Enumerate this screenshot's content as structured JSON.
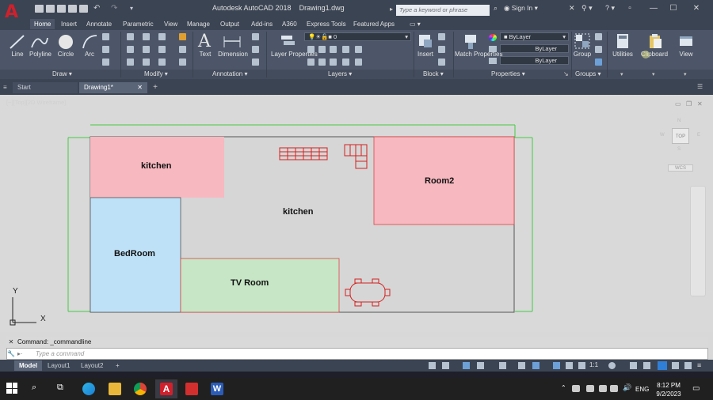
{
  "app": {
    "title": "Autodesk AutoCAD 2018",
    "document": "Drawing1.dwg",
    "search_placeholder": "Type a keyword or phrase",
    "sign_in": "Sign In",
    "logo_letter": "A"
  },
  "menu_tabs": [
    "Home",
    "Insert",
    "Annotate",
    "Parametric",
    "View",
    "Manage",
    "Output",
    "Add-ins",
    "A360",
    "Express Tools",
    "Featured Apps"
  ],
  "active_tab": "Home",
  "ribbon": {
    "draw": {
      "label": "Draw",
      "tools": [
        "Line",
        "Polyline",
        "Circle",
        "Arc"
      ]
    },
    "modify": {
      "label": "Modify"
    },
    "annotation": {
      "label": "Annotation",
      "tools": [
        "Text",
        "Dimension"
      ]
    },
    "layers": {
      "label": "Layers",
      "tool": "Layer Properties",
      "current_layer": "0"
    },
    "block": {
      "label": "Block",
      "tool": "Insert"
    },
    "properties": {
      "label": "Properties",
      "tool": "Match Properties",
      "color": "ByLayer",
      "linetype": "ByLayer",
      "lineweight": "ByLayer"
    },
    "groups": {
      "label": "Groups",
      "tool": "Group"
    },
    "utilities": {
      "label": "Utilities"
    },
    "clipboard": {
      "label": "Clipboard"
    },
    "view": {
      "label": "View"
    }
  },
  "file_tabs": [
    "Start",
    "Drawing1*"
  ],
  "viewport_label": "[−][Top][2D Wireframe]",
  "viewcube": {
    "top": "TOP",
    "north": "N",
    "south": "S",
    "west": "W",
    "east": "E",
    "wcs": "WCS"
  },
  "floor_plan": {
    "rooms": [
      {
        "name": "kitchen",
        "color": "#f7b8c0"
      },
      {
        "name": "kitchen",
        "color": "#d6d6d6"
      },
      {
        "name": "Room2",
        "color": "#f7b8c0"
      },
      {
        "name": "BedRoom",
        "color": "#bfe1f7"
      },
      {
        "name": "TV Room",
        "color": "#c6e6c6"
      }
    ]
  },
  "ucs": {
    "x": "X",
    "y": "Y"
  },
  "command": {
    "history": "Command: _commandline",
    "placeholder": "Type a command"
  },
  "layout_tabs": [
    "Model",
    "Layout1",
    "Layout2"
  ],
  "status": {
    "scale": "1:1"
  },
  "taskbar": {
    "lang": "ENG",
    "time": "8:12 PM",
    "date": "9/2/2023"
  },
  "colors": {
    "accent": "#d1202b",
    "ribbon": "#4c5668",
    "titlebar": "#3b4453",
    "canvas": "#d9d9d9"
  }
}
